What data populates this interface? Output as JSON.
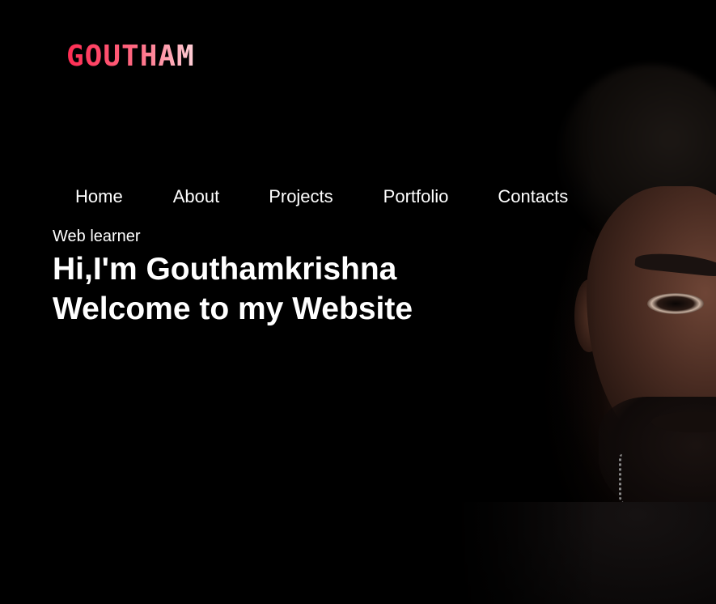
{
  "brand": {
    "logo_text": "GOUTHAM",
    "gradient_colors": [
      "#ff2b52",
      "#ff6b83",
      "#ffd1d8"
    ]
  },
  "nav": {
    "items": [
      {
        "label": "Home"
      },
      {
        "label": "About"
      },
      {
        "label": "Projects"
      },
      {
        "label": "Portfolio"
      },
      {
        "label": "Contacts"
      }
    ]
  },
  "hero": {
    "subtitle": "Web learner",
    "headline_line1": "Hi,I'm Gouthamkrishna",
    "headline_line2": "Welcome to my Website",
    "photo_icon": "portrait-photo"
  },
  "colors": {
    "background": "#000000",
    "text": "#ffffff"
  }
}
